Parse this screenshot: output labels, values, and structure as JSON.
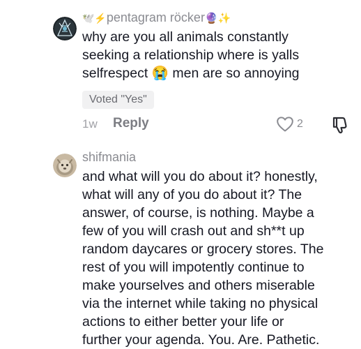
{
  "comments": [
    {
      "username": "ἴὮ⚠pentagram röcker🔮✨",
      "username_text": "pentagram röcker",
      "username_prefix": "🕊️⚡",
      "username_suffix": "🔮✨",
      "text": "why are you all animals constantly\nseeking a relationship where is yalls\nselfrespect 😭 men are so annoying",
      "vote_label": "Voted \"Yes\"",
      "time": "1w",
      "reply_label": "Reply",
      "like_count": "2",
      "icons": {
        "like": "heart-outline-icon",
        "dislike": "thumbs-down-outline-icon"
      }
    },
    {
      "username": "shifmania",
      "text": "and what will you do about it? honestly,\nwhat will any of you do about it? The\nanswer, of course, is nothing. Maybe a\nfew of you will crash out and sh**t up\nrandom daycares or grocery stores. The\nrest of you will impotently continue to\nmake yourselves and others miserable\nvia the internet while taking no physical\nactions to either better your life or\nfurther your agenda. You. Are. Pathetic."
    }
  ],
  "colors": {
    "text_primary": "#161823",
    "text_secondary": "#8a8b91",
    "badge_bg": "#f1f1f2"
  }
}
